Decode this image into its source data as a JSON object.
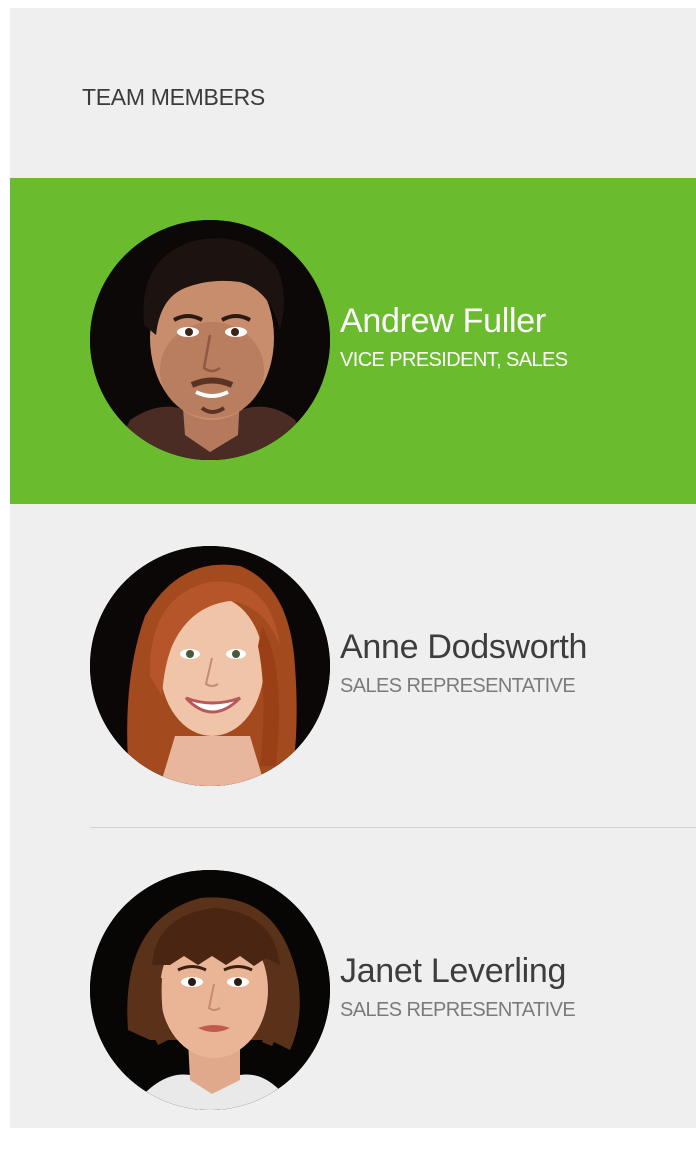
{
  "panel": {
    "title": "TEAM MEMBERS"
  },
  "members": [
    {
      "name": "Andrew Fuller",
      "role": "VICE PRESIDENT, SALES",
      "selected": true,
      "avatar_icon": "avatar-man-photo"
    },
    {
      "name": "Anne Dodsworth",
      "role": "SALES REPRESENTATIVE",
      "selected": false,
      "avatar_icon": "avatar-woman-red-hair-photo"
    },
    {
      "name": "Janet Leverling",
      "role": "SALES REPRESENTATIVE",
      "selected": false,
      "avatar_icon": "avatar-woman-bangs-photo"
    }
  ],
  "colors": {
    "selected_background": "#6bbb2f",
    "panel_background": "#efefef",
    "name_text": "#3d3d3d",
    "role_text": "#7b7b7b"
  }
}
